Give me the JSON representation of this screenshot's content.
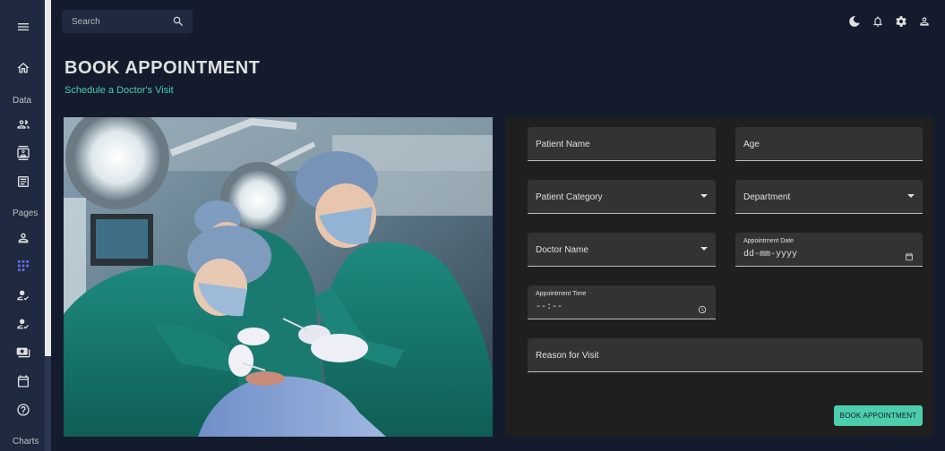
{
  "sidebar": {
    "menu_icon": "hamburger-menu-icon",
    "sections": {
      "data": "Data",
      "pages": "Pages",
      "charts": "Charts"
    }
  },
  "search": {
    "placeholder": "Search"
  },
  "header_icons": [
    "dark-mode-icon",
    "notifications-icon",
    "settings-icon",
    "user-profile-icon"
  ],
  "page": {
    "title": "BOOK APPOINTMENT",
    "subtitle": "Schedule a Doctor's Visit"
  },
  "form": {
    "patient_name": "Patient Name",
    "age": "Age",
    "patient_category": "Patient Category",
    "department": "Department",
    "doctor_name": "Doctor Name",
    "appointment_date_label": "Appointment Date",
    "appointment_date_value": "dd-mm-yyyy",
    "appointment_time_label": "Appointment Time",
    "appointment_time_value": "--:--",
    "reason": "Reason for Visit",
    "submit": "BOOK APPOINTMENT"
  },
  "colors": {
    "background": "#141b2d",
    "sidebar": "#1f2a40",
    "accent_green": "#4cceac",
    "accent_blue": "#6870fa",
    "card": "#1f1f1f",
    "field": "#333333"
  }
}
